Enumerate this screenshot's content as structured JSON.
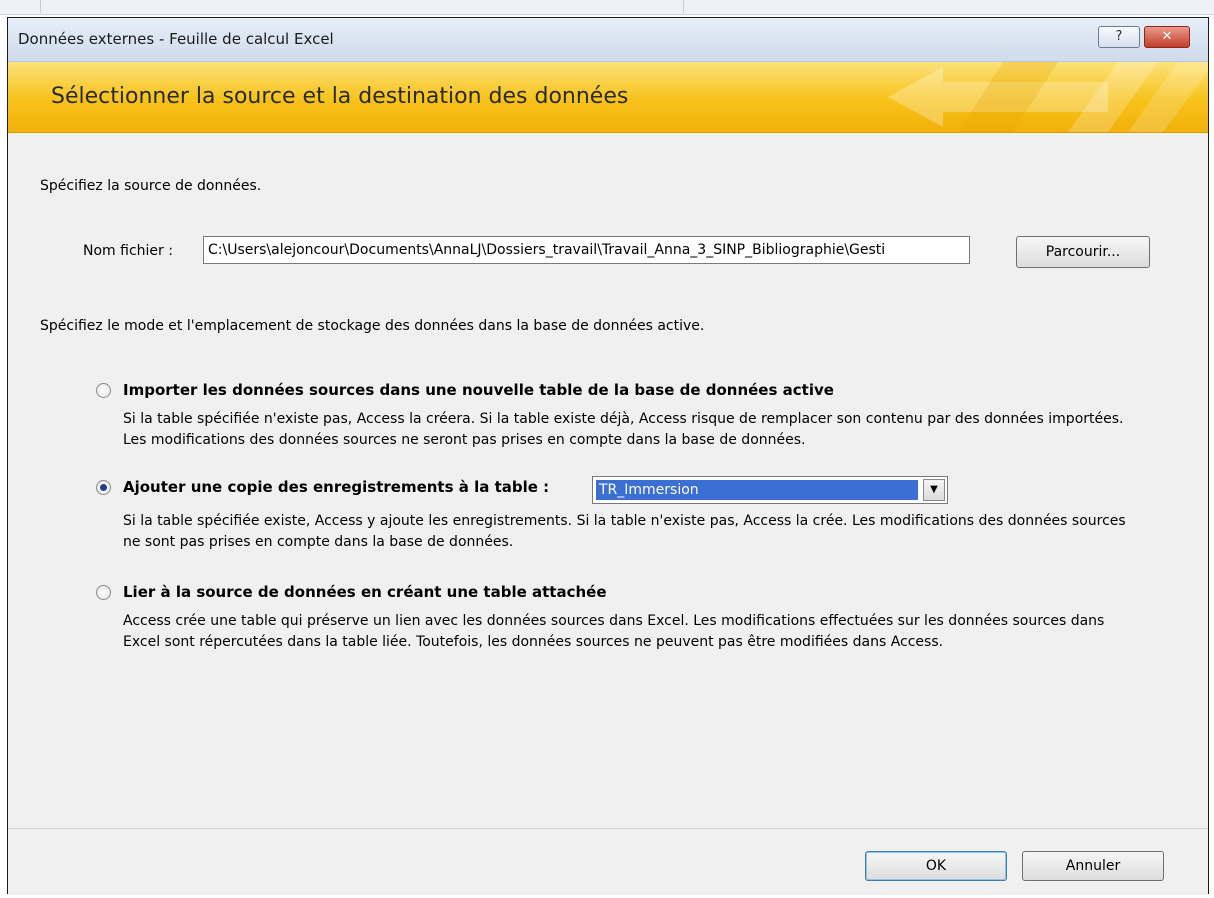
{
  "window": {
    "title": "Données externes - Feuille de calcul Excel",
    "help_label": "?",
    "close_label": "✕"
  },
  "banner": {
    "title": "Sélectionner la source et la destination des données"
  },
  "source": {
    "label": "Spécifiez la source de données.",
    "file_label": "Nom fichier :",
    "file_value": "C:\\Users\\alejoncour\\Documents\\AnnaLJ\\Dossiers_travail\\Travail_Anna_3_SINP_Bibliographie\\Gesti",
    "browse_label": "Parcourir..."
  },
  "mode": {
    "label": "Spécifiez le mode et l'emplacement de stockage des données dans la base de données active.",
    "options": [
      {
        "title": "Importer les données sources dans une nouvelle table de la base de données active",
        "desc": "Si la table spécifiée n'existe pas, Access la créera. Si la table existe déjà, Access risque de remplacer son contenu par des données importées. Les modifications des données sources ne seront pas prises en compte dans la base de données.",
        "checked": false
      },
      {
        "title": "Ajouter une copie des enregistrements à la table :",
        "desc": "Si la table spécifiée existe, Access y ajoute les enregistrements. Si la table n'existe pas, Access la crée. Les modifications des données sources ne sont pas prises en compte dans la base de données.",
        "checked": true,
        "combo_value": "TR_Immersion"
      },
      {
        "title": "Lier à la source de données en créant une table attachée",
        "desc": "Access crée une table qui préserve un lien avec les données sources dans Excel. Les modifications effectuées sur les données sources dans Excel sont répercutées dans la table liée. Toutefois, les données sources ne peuvent pas être modifiées dans Access.",
        "checked": false
      }
    ]
  },
  "footer": {
    "ok_label": "OK",
    "cancel_label": "Annuler"
  },
  "colors": {
    "banner_yellow": "#f7c21a",
    "selection_blue": "#3b6fd3",
    "radio_dot": "#1e3f8a"
  }
}
